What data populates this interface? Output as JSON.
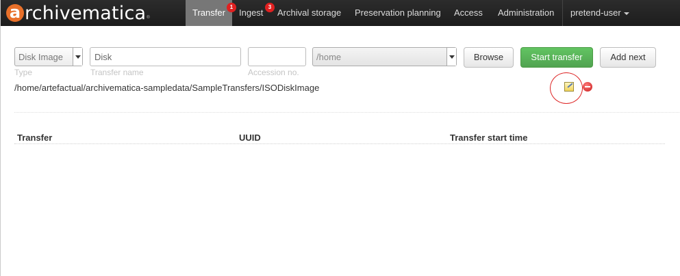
{
  "brand": {
    "letter": "a",
    "text": "rchivematica",
    "reg": "®"
  },
  "nav": {
    "items": [
      {
        "label": "Transfer",
        "badge": "1"
      },
      {
        "label": "Ingest",
        "badge": "3"
      },
      {
        "label": "Archival storage"
      },
      {
        "label": "Preservation planning"
      },
      {
        "label": "Access"
      },
      {
        "label": "Administration"
      }
    ],
    "user": "pretend-user"
  },
  "form": {
    "type_value": "Disk Image",
    "name_value": "Disk",
    "accession_value": "",
    "location_value": "/home",
    "type_label": "Type",
    "name_label": "Transfer name",
    "accession_label": "Accession no.",
    "browse": "Browse",
    "start": "Start transfer",
    "add_next": "Add next"
  },
  "selected_path": "/home/artefactual/archivematica-sampledata/SampleTransfers/ISODiskImage",
  "table": {
    "headers": [
      "Transfer",
      "UUID",
      "Transfer start time"
    ]
  },
  "colors": {
    "accent_green": "#5bb75b",
    "brand_orange": "#e8702a",
    "badge_red": "#e02020",
    "annotation_red": "#dd2222"
  }
}
